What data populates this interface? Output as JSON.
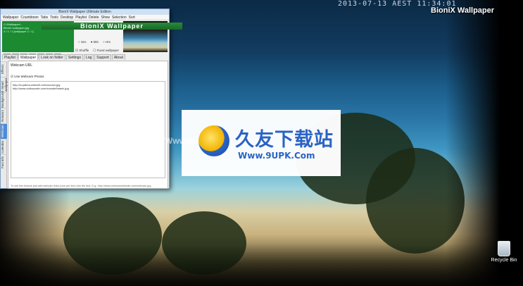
{
  "window": {
    "title": "BioniX Wallpaper Ultimate Edition",
    "menu": [
      "Wallpaper",
      "Countdown",
      "Tabs",
      "Tools",
      "Desktop",
      "Playlist",
      "Delete",
      "Show",
      "Selection",
      "Sort"
    ],
    "banner": "BioniX Wallpaper",
    "info_lines": [
      "C:\\Wallpaper\\...",
      "BioniX wallpaper.jpg",
      "4 / 1 / 1  [wallpaper 1 / 1]"
    ],
    "next_label": "Next wallpaper in:  25 minutes",
    "radios": [
      "Sec",
      "Min",
      "Hrs"
    ],
    "checks": [
      "Shuffle",
      "Fixed wallpaper"
    ],
    "controls": [
      "◀◀",
      "▶",
      "■",
      "▶▶",
      "◀",
      "▶",
      "?"
    ],
    "tabs": [
      "Playlist",
      "Wallpaper",
      "Look on folder",
      "Settings",
      "Log",
      "Support",
      "About"
    ],
    "active_tab": "Wallpaper",
    "side_tabs": [
      "Effects",
      "Smart wallpaper",
      "Background",
      "Rotators",
      "Webcam",
      "Calendar",
      "Fast info"
    ],
    "panel_header": "Webcam URL",
    "use_webcam_label": "Use Webcam Photos",
    "urls": [
      "http://w.palma.webcell.net/coucam.jpg",
      "http://www.solbuscafe.com/ecsnde/beach.jpg"
    ],
    "hint": "To use this feature just add webcam links (one per line) into the text. E.g.: http://www.webcamwebsite.com/webcam.jpg"
  },
  "desktop": {
    "timestamp": "2013-07-13 AEST 11:34:01",
    "brand": "BioniX Wallpaper",
    "recycle_bin": "Recycle Bin",
    "watermark_cn": "久友下载站",
    "watermark_url": "Www.9UPK.Com",
    "watermark_left": "Www.9UPK.Com"
  }
}
